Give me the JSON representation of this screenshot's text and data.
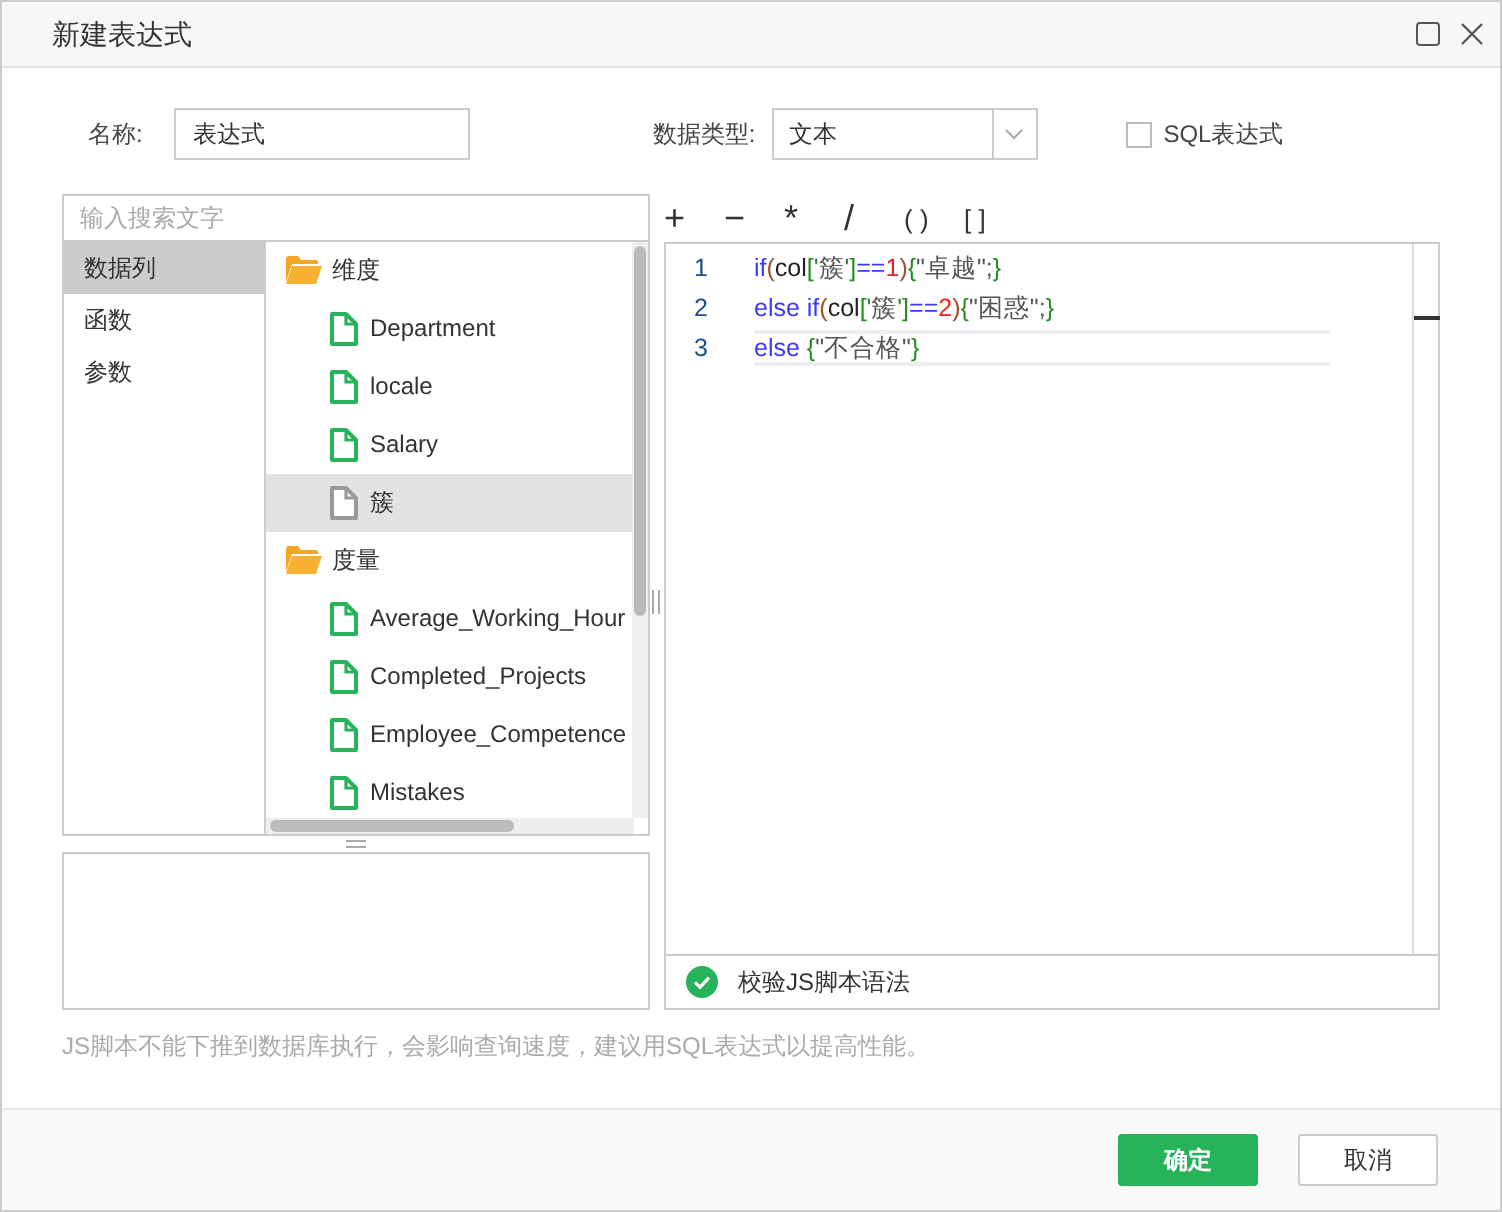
{
  "dialog": {
    "title": "新建表达式"
  },
  "name_field": {
    "label": "名称:",
    "value": "表达式"
  },
  "data_type": {
    "label": "数据类型:",
    "value": "文本"
  },
  "sql_expression": {
    "label": "SQL表达式",
    "checked": false
  },
  "search": {
    "placeholder": "输入搜索文字"
  },
  "categories": [
    {
      "label": "数据列",
      "selected": true
    },
    {
      "label": "函数",
      "selected": false
    },
    {
      "label": "参数",
      "selected": false
    }
  ],
  "tree": [
    {
      "label": "维度",
      "children": [
        {
          "label": "Department",
          "selected": false
        },
        {
          "label": "locale",
          "selected": false
        },
        {
          "label": "Salary",
          "selected": false
        },
        {
          "label": "簇",
          "selected": true
        }
      ]
    },
    {
      "label": "度量",
      "children": [
        {
          "label": "Average_Working_Hour",
          "selected": false
        },
        {
          "label": "Completed_Projects",
          "selected": false
        },
        {
          "label": "Employee_Competence",
          "selected": false
        },
        {
          "label": "Mistakes",
          "selected": false
        }
      ]
    }
  ],
  "operators": [
    "+",
    "−",
    "*",
    "/",
    "( )",
    "[ ]"
  ],
  "code_lines": [
    {
      "number": "1",
      "active": false,
      "tokens": [
        {
          "kind": "keyword",
          "text": "if"
        },
        {
          "kind": "paren",
          "text": "("
        },
        {
          "kind": "ident",
          "text": "col"
        },
        {
          "kind": "bracket",
          "text": "['"
        },
        {
          "kind": "string",
          "text": "簇"
        },
        {
          "kind": "bracket",
          "text": "']"
        },
        {
          "kind": "operator",
          "text": "=="
        },
        {
          "kind": "number",
          "text": "1"
        },
        {
          "kind": "paren",
          "text": ")"
        },
        {
          "kind": "bracket",
          "text": "{"
        },
        {
          "kind": "string",
          "text": "\"卓越\";"
        },
        {
          "kind": "bracket",
          "text": "}"
        }
      ]
    },
    {
      "number": "2",
      "active": false,
      "tokens": [
        {
          "kind": "keyword",
          "text": "else if"
        },
        {
          "kind": "paren",
          "text": "("
        },
        {
          "kind": "ident",
          "text": "col"
        },
        {
          "kind": "bracket",
          "text": "['"
        },
        {
          "kind": "string",
          "text": "簇"
        },
        {
          "kind": "bracket",
          "text": "']"
        },
        {
          "kind": "operator",
          "text": "=="
        },
        {
          "kind": "number",
          "text": "2"
        },
        {
          "kind": "paren",
          "text": ")"
        },
        {
          "kind": "bracket",
          "text": "{"
        },
        {
          "kind": "string",
          "text": "\"困惑\";"
        },
        {
          "kind": "bracket",
          "text": "}"
        }
      ]
    },
    {
      "number": "3",
      "active": true,
      "tokens": [
        {
          "kind": "keyword",
          "text": "else "
        },
        {
          "kind": "bracket",
          "text": "{"
        },
        {
          "kind": "string",
          "text": "\"不合格\""
        },
        {
          "kind": "bracket",
          "text": "}"
        }
      ]
    }
  ],
  "validate": {
    "label": "校验JS脚本语法"
  },
  "hint": "JS脚本不能下推到数据库执行，会影响查询速度，建议用SQL表达式以提高性能。",
  "buttons": [
    {
      "label": "确定",
      "kind": "primary"
    },
    {
      "label": "取消",
      "kind": "secondary"
    }
  ]
}
